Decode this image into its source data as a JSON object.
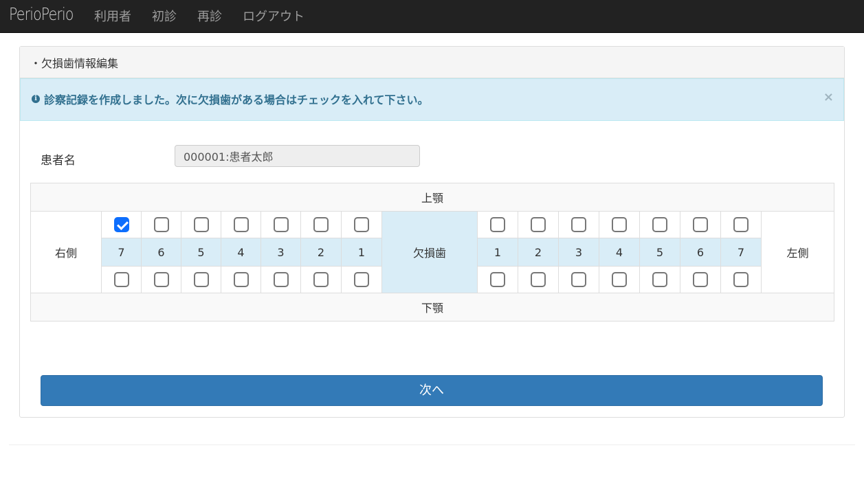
{
  "nav": {
    "brand": "PerioPerio",
    "items": [
      "利用者",
      "初診",
      "再診",
      "ログアウト"
    ]
  },
  "panel": {
    "title": "・欠損歯情報編集"
  },
  "alert": {
    "icon": "info-icon",
    "message": "診察記録を作成しました。次に欠損歯がある場合はチェックを入れて下さい。",
    "close": "×"
  },
  "patient": {
    "label": "患者名",
    "value": "000001:患者太郎"
  },
  "teeth": {
    "upper_label": "上顎",
    "lower_label": "下顎",
    "right_label": "右側",
    "left_label": "左側",
    "center_label": "欠損歯",
    "right_numbers": [
      "7",
      "6",
      "5",
      "4",
      "3",
      "2",
      "1"
    ],
    "left_numbers": [
      "1",
      "2",
      "3",
      "4",
      "5",
      "6",
      "7"
    ],
    "upper_right_checked": [
      true,
      false,
      false,
      false,
      false,
      false,
      false
    ],
    "upper_left_checked": [
      false,
      false,
      false,
      false,
      false,
      false,
      false
    ],
    "lower_right_checked": [
      false,
      false,
      false,
      false,
      false,
      false,
      false
    ],
    "lower_left_checked": [
      false,
      false,
      false,
      false,
      false,
      false,
      false
    ]
  },
  "actions": {
    "next_label": "次へ"
  },
  "colors": {
    "navbar": "#222222",
    "primary": "#337ab7",
    "info_bg": "#d9edf7",
    "info_text": "#31708f",
    "checkbox_checked": "#0d6efd"
  }
}
